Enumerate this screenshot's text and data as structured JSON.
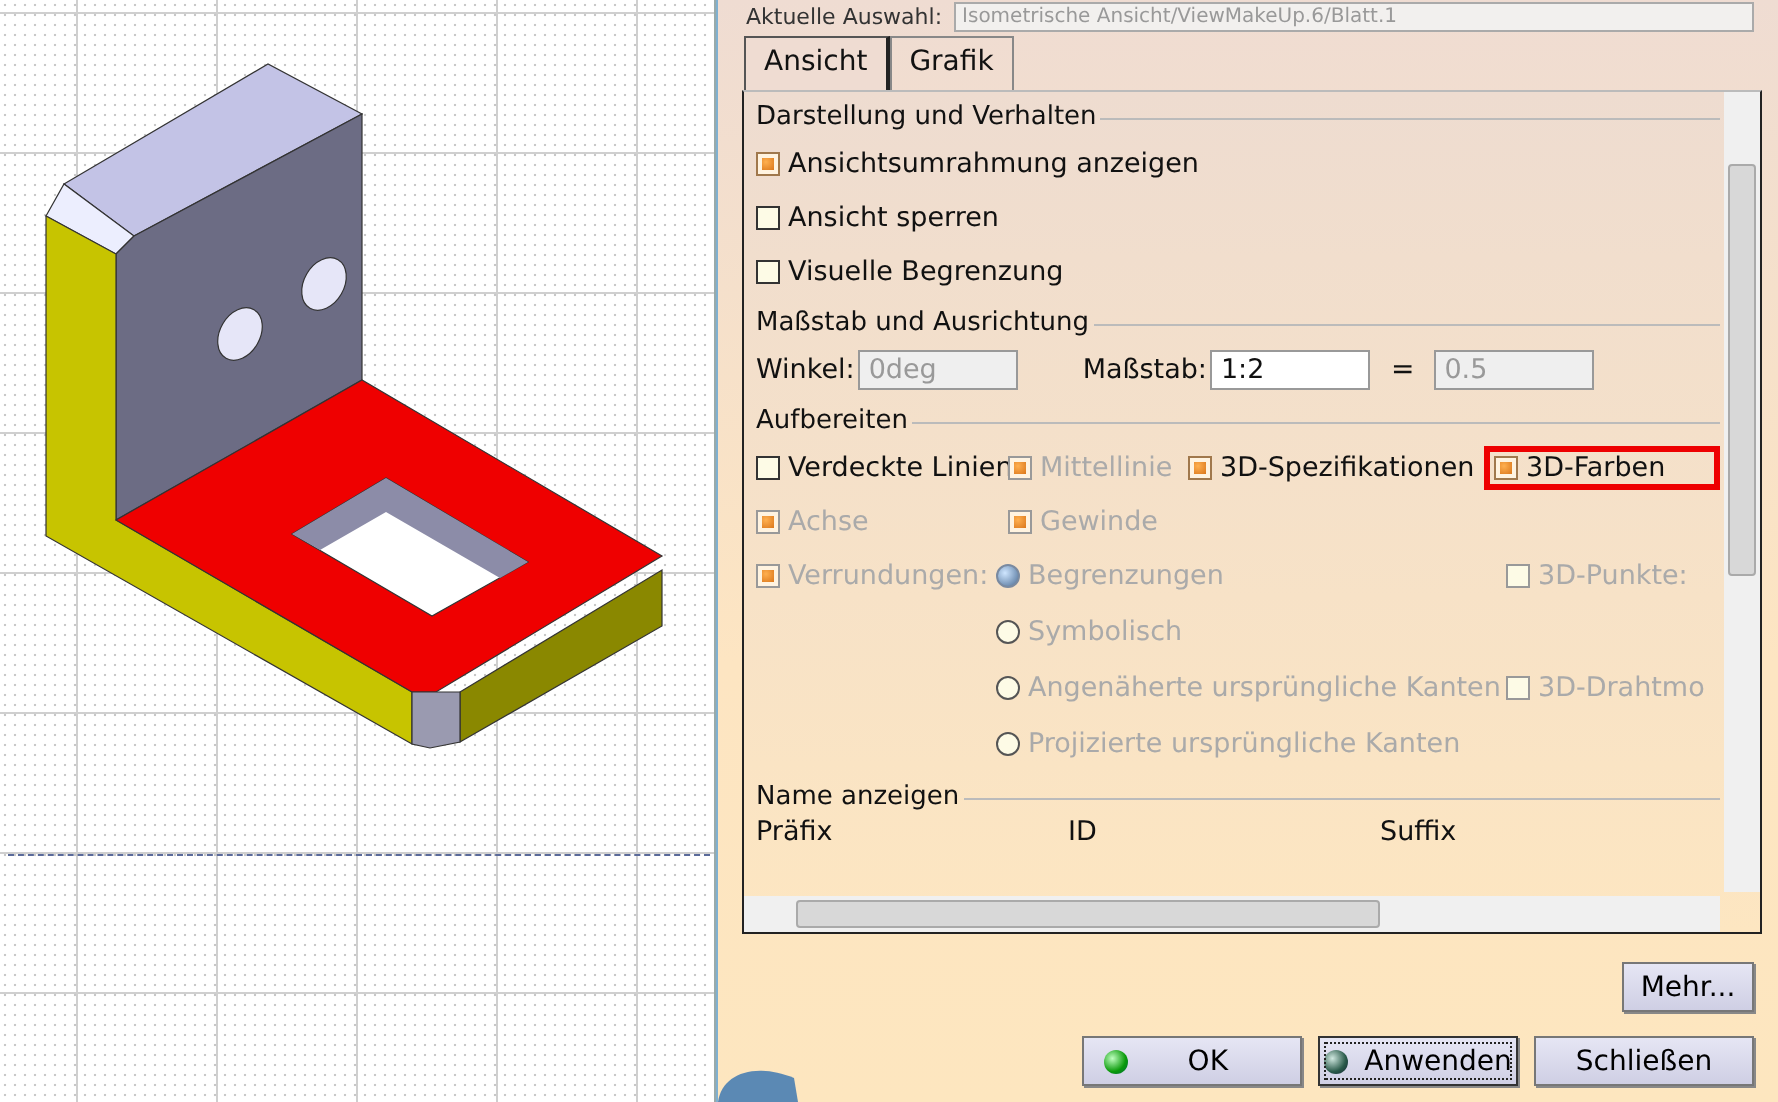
{
  "selection": {
    "label": "Aktuelle Auswahl:",
    "value": "Isometrische Ansicht/ViewMakeUp.6/Blatt.1"
  },
  "tabs": [
    {
      "label": "Ansicht",
      "selected": true
    },
    {
      "label": "Grafik",
      "selected": false
    }
  ],
  "display": {
    "title": "Darstellung und Verhalten",
    "options": [
      {
        "label": "Ansichtsumrahmung anzeigen",
        "checked": true
      },
      {
        "label": "Ansicht sperren",
        "checked": false
      },
      {
        "label": "Visuelle Begrenzung",
        "checked": false
      }
    ]
  },
  "scale": {
    "title": "Maßstab und Ausrichtung",
    "angle": {
      "label": "Winkel:",
      "value": "0deg",
      "disabled": true
    },
    "scale": {
      "label": "Maßstab:",
      "value": "1:2",
      "disabled": false
    },
    "equals": "=",
    "ratio": {
      "value": "0.5",
      "disabled": true
    }
  },
  "dress_up": {
    "title": "Aufbereiten",
    "options": [
      {
        "label": "Verdeckte Linien",
        "checked": false,
        "disabled": false,
        "highlighted": false
      },
      {
        "label": "Mittellinie",
        "checked": true,
        "disabled": true,
        "highlighted": false
      },
      {
        "label": "3D-Spezifikationen",
        "checked": true,
        "disabled": false,
        "highlighted": false
      },
      {
        "label": "3D-Farben",
        "checked": true,
        "disabled": false,
        "highlighted": true
      },
      {
        "label": "Achse",
        "checked": true,
        "disabled": true,
        "highlighted": false
      },
      {
        "label": "Gewinde",
        "checked": true,
        "disabled": true,
        "highlighted": false
      }
    ],
    "fillets": {
      "label": "Verrundungen:",
      "checked": true,
      "disabled": true,
      "modes": [
        {
          "label": "Begrenzungen",
          "selected": true,
          "disabled": true
        },
        {
          "label": "Symbolisch",
          "selected": false,
          "disabled": true
        },
        {
          "label": "Angenäherte ursprüngliche Kanten",
          "selected": false,
          "disabled": true
        },
        {
          "label": "Projizierte ursprüngliche Kanten",
          "selected": false,
          "disabled": true
        }
      ]
    },
    "extras": [
      {
        "label": "3D-Punkte:",
        "checked": false,
        "disabled": true
      },
      {
        "label": "3D-Drahtmo",
        "checked": false,
        "disabled": true
      }
    ]
  },
  "name_display": {
    "title": "Name anzeigen",
    "columns": [
      "Präfix",
      "ID",
      "Suffix"
    ]
  },
  "buttons": [
    {
      "label": "Mehr...",
      "kind": "more",
      "focused": false
    },
    {
      "label": "OK",
      "kind": "ok",
      "focused": false
    },
    {
      "label": "Anwenden",
      "kind": "apply",
      "focused": true
    },
    {
      "label": "Schließen",
      "kind": "close",
      "focused": false
    }
  ]
}
